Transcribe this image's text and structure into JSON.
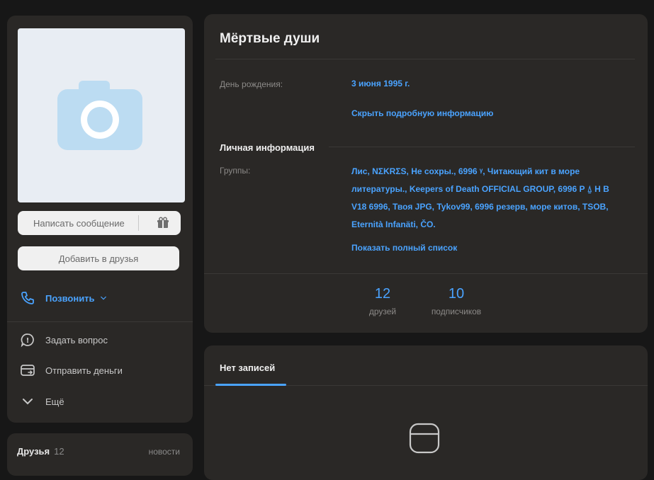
{
  "profile": {
    "name": "Мёртвые души",
    "birthday_label": "День рождения:",
    "birthday_value": "3 июня 1995 г.",
    "hide_info": "Скрыть подробную информацию",
    "personal_title": "Личная информация",
    "groups_label": "Группы:",
    "groups_value": "Лис, NΣKRΣS, Не сохры., 6996 ᵞ, Читающий кит в море литературы., Keepers of Death OFFICIAL GROUP, 6996 P ⍙ H B V18 6996, Твоя JPG, Tykov99, 6996 резерв, море китов, TSOB, Eternità Infanäti, ČO.",
    "show_full": "Показать полный список"
  },
  "stats": {
    "friends_count": "12",
    "friends_label": "друзей",
    "followers_count": "10",
    "followers_label": "подписчиков"
  },
  "left": {
    "message_button": "Написать сообщение",
    "add_friend_button": "Добавить в друзья",
    "call": "Позвонить",
    "ask": "Задать вопрос",
    "send_money": "Отправить деньги",
    "more": "Ещё"
  },
  "friends": {
    "title": "Друзья",
    "count": "12",
    "news": "новости"
  },
  "wall": {
    "tab": "Нет записей"
  },
  "colors": {
    "accent": "#4aa3ff",
    "panel": "#2a2826",
    "background": "#171717"
  }
}
